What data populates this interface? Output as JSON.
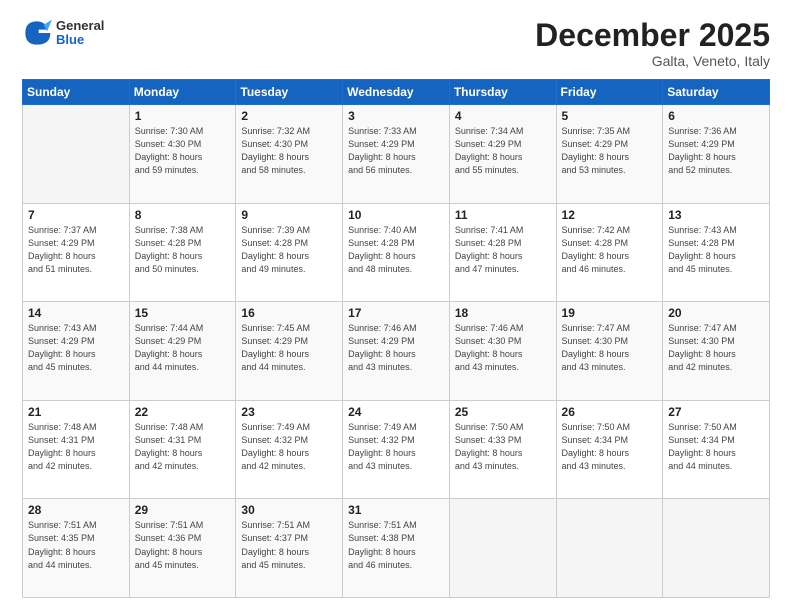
{
  "header": {
    "logo": {
      "general": "General",
      "blue": "Blue"
    },
    "title": "December 2025",
    "location": "Galta, Veneto, Italy"
  },
  "calendar": {
    "days_of_week": [
      "Sunday",
      "Monday",
      "Tuesday",
      "Wednesday",
      "Thursday",
      "Friday",
      "Saturday"
    ],
    "weeks": [
      [
        {
          "day": "",
          "info": ""
        },
        {
          "day": "1",
          "info": "Sunrise: 7:30 AM\nSunset: 4:30 PM\nDaylight: 8 hours\nand 59 minutes."
        },
        {
          "day": "2",
          "info": "Sunrise: 7:32 AM\nSunset: 4:30 PM\nDaylight: 8 hours\nand 58 minutes."
        },
        {
          "day": "3",
          "info": "Sunrise: 7:33 AM\nSunset: 4:29 PM\nDaylight: 8 hours\nand 56 minutes."
        },
        {
          "day": "4",
          "info": "Sunrise: 7:34 AM\nSunset: 4:29 PM\nDaylight: 8 hours\nand 55 minutes."
        },
        {
          "day": "5",
          "info": "Sunrise: 7:35 AM\nSunset: 4:29 PM\nDaylight: 8 hours\nand 53 minutes."
        },
        {
          "day": "6",
          "info": "Sunrise: 7:36 AM\nSunset: 4:29 PM\nDaylight: 8 hours\nand 52 minutes."
        }
      ],
      [
        {
          "day": "7",
          "info": "Sunrise: 7:37 AM\nSunset: 4:29 PM\nDaylight: 8 hours\nand 51 minutes."
        },
        {
          "day": "8",
          "info": "Sunrise: 7:38 AM\nSunset: 4:28 PM\nDaylight: 8 hours\nand 50 minutes."
        },
        {
          "day": "9",
          "info": "Sunrise: 7:39 AM\nSunset: 4:28 PM\nDaylight: 8 hours\nand 49 minutes."
        },
        {
          "day": "10",
          "info": "Sunrise: 7:40 AM\nSunset: 4:28 PM\nDaylight: 8 hours\nand 48 minutes."
        },
        {
          "day": "11",
          "info": "Sunrise: 7:41 AM\nSunset: 4:28 PM\nDaylight: 8 hours\nand 47 minutes."
        },
        {
          "day": "12",
          "info": "Sunrise: 7:42 AM\nSunset: 4:28 PM\nDaylight: 8 hours\nand 46 minutes."
        },
        {
          "day": "13",
          "info": "Sunrise: 7:43 AM\nSunset: 4:28 PM\nDaylight: 8 hours\nand 45 minutes."
        }
      ],
      [
        {
          "day": "14",
          "info": "Sunrise: 7:43 AM\nSunset: 4:29 PM\nDaylight: 8 hours\nand 45 minutes."
        },
        {
          "day": "15",
          "info": "Sunrise: 7:44 AM\nSunset: 4:29 PM\nDaylight: 8 hours\nand 44 minutes."
        },
        {
          "day": "16",
          "info": "Sunrise: 7:45 AM\nSunset: 4:29 PM\nDaylight: 8 hours\nand 44 minutes."
        },
        {
          "day": "17",
          "info": "Sunrise: 7:46 AM\nSunset: 4:29 PM\nDaylight: 8 hours\nand 43 minutes."
        },
        {
          "day": "18",
          "info": "Sunrise: 7:46 AM\nSunset: 4:30 PM\nDaylight: 8 hours\nand 43 minutes."
        },
        {
          "day": "19",
          "info": "Sunrise: 7:47 AM\nSunset: 4:30 PM\nDaylight: 8 hours\nand 43 minutes."
        },
        {
          "day": "20",
          "info": "Sunrise: 7:47 AM\nSunset: 4:30 PM\nDaylight: 8 hours\nand 42 minutes."
        }
      ],
      [
        {
          "day": "21",
          "info": "Sunrise: 7:48 AM\nSunset: 4:31 PM\nDaylight: 8 hours\nand 42 minutes."
        },
        {
          "day": "22",
          "info": "Sunrise: 7:48 AM\nSunset: 4:31 PM\nDaylight: 8 hours\nand 42 minutes."
        },
        {
          "day": "23",
          "info": "Sunrise: 7:49 AM\nSunset: 4:32 PM\nDaylight: 8 hours\nand 42 minutes."
        },
        {
          "day": "24",
          "info": "Sunrise: 7:49 AM\nSunset: 4:32 PM\nDaylight: 8 hours\nand 43 minutes."
        },
        {
          "day": "25",
          "info": "Sunrise: 7:50 AM\nSunset: 4:33 PM\nDaylight: 8 hours\nand 43 minutes."
        },
        {
          "day": "26",
          "info": "Sunrise: 7:50 AM\nSunset: 4:34 PM\nDaylight: 8 hours\nand 43 minutes."
        },
        {
          "day": "27",
          "info": "Sunrise: 7:50 AM\nSunset: 4:34 PM\nDaylight: 8 hours\nand 44 minutes."
        }
      ],
      [
        {
          "day": "28",
          "info": "Sunrise: 7:51 AM\nSunset: 4:35 PM\nDaylight: 8 hours\nand 44 minutes."
        },
        {
          "day": "29",
          "info": "Sunrise: 7:51 AM\nSunset: 4:36 PM\nDaylight: 8 hours\nand 45 minutes."
        },
        {
          "day": "30",
          "info": "Sunrise: 7:51 AM\nSunset: 4:37 PM\nDaylight: 8 hours\nand 45 minutes."
        },
        {
          "day": "31",
          "info": "Sunrise: 7:51 AM\nSunset: 4:38 PM\nDaylight: 8 hours\nand 46 minutes."
        },
        {
          "day": "",
          "info": ""
        },
        {
          "day": "",
          "info": ""
        },
        {
          "day": "",
          "info": ""
        }
      ]
    ]
  }
}
